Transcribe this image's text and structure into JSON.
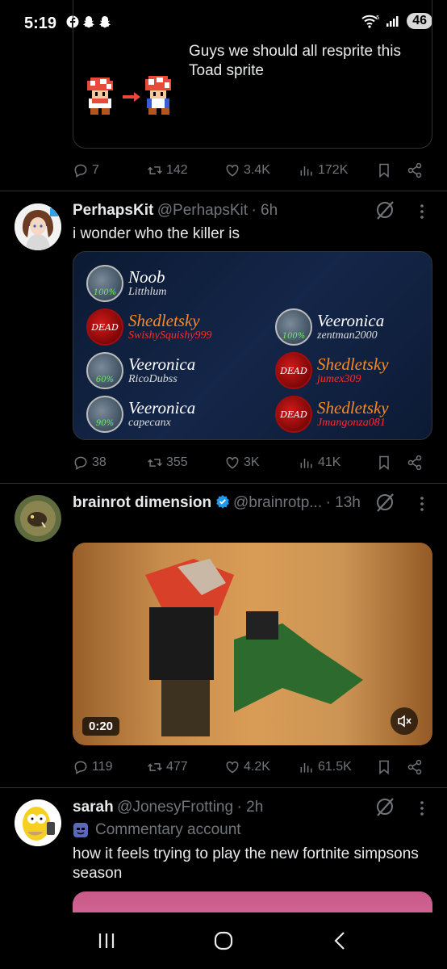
{
  "status_bar": {
    "time": "5:19",
    "network_superscript": "5",
    "battery": "46"
  },
  "tweet1": {
    "text": "Guys we should all resprite this Toad sprite",
    "stats": {
      "replies": "7",
      "reposts": "142",
      "likes": "3.4K",
      "views": "172K"
    }
  },
  "tweet2": {
    "name": "PerhapsKit",
    "handle": "@PerhapsKit",
    "time": "· 6h",
    "text": "i wonder who the killer is",
    "leaderboard": [
      {
        "role": "Noob",
        "user": "Litthlum",
        "status": "100%",
        "role_color": "#ffffff",
        "user_color": "#dddddd",
        "dead": false
      },
      {
        "role": "Shedletsky",
        "user": "SwishySquishy999",
        "status": "DEAD",
        "role_color": "#ff8a1e",
        "user_color": "#ff2b2b",
        "dead": true
      },
      {
        "role": "Veeronica",
        "user": "RicoDubss",
        "status": "60%",
        "role_color": "#ffffff",
        "user_color": "#dddddd",
        "dead": false
      },
      {
        "role": "Veeronica",
        "user": "capecanx",
        "status": "90%",
        "role_color": "#ffffff",
        "user_color": "#dddddd",
        "dead": false
      },
      {
        "role": "Veeronica",
        "user": "zentman2000",
        "status": "100%",
        "role_color": "#ffffff",
        "user_color": "#dddddd",
        "dead": false
      },
      {
        "role": "Shedletsky",
        "user": "jumex309",
        "status": "DEAD",
        "role_color": "#ff8a1e",
        "user_color": "#ff2b2b",
        "dead": true
      },
      {
        "role": "Shedletsky",
        "user": "Jmangonza081",
        "status": "DEAD",
        "role_color": "#ff8a1e",
        "user_color": "#ff2b2b",
        "dead": true
      }
    ],
    "stats": {
      "replies": "38",
      "reposts": "355",
      "likes": "3K",
      "views": "41K"
    }
  },
  "tweet3": {
    "name": "brainrot dimension",
    "handle": "@brainrotp...",
    "time": "· 13h",
    "video_time": "0:20",
    "stats": {
      "replies": "119",
      "reposts": "477",
      "likes": "4.2K",
      "views": "61.5K"
    }
  },
  "tweet4": {
    "name": "sarah",
    "handle": "@JonesyFrotting",
    "time": "· 2h",
    "label": "Commentary account",
    "text": "how it feels trying to play the new fortnite simpsons season"
  },
  "colors": {
    "muted": "#71767b",
    "verified": "#1d9bf0",
    "divider": "#2f3336"
  },
  "icons": [
    "reply-icon",
    "repost-icon",
    "like-icon",
    "views-icon",
    "bookmark-icon",
    "share-icon",
    "grok-icon",
    "more-icon",
    "verified-icon",
    "mute-icon"
  ]
}
